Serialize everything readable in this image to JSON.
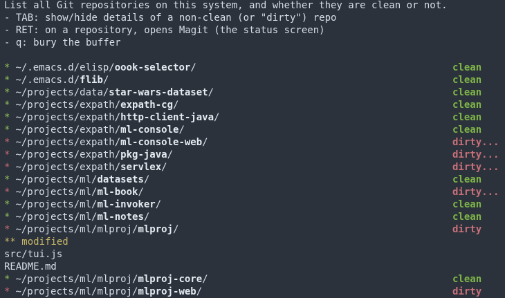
{
  "help": {
    "title": "List all Git repositories on this system, and whether they are clean or not.",
    "tab_line": "- TAB: show/hide details of a non-clean (or \"dirty\") repo",
    "ret_line": "- RET: on a repository, opens Magit (the status screen)",
    "q_line": "- q: bury the buffer"
  },
  "bullet": "*",
  "repos": [
    {
      "prefix": "~/.emacs.d/elisp/",
      "name": "oook-selector",
      "status": "clean"
    },
    {
      "prefix": "~/.emacs.d/",
      "name": "flib",
      "status": "clean"
    },
    {
      "prefix": "~/projects/data/",
      "name": "star-wars-dataset",
      "status": "clean"
    },
    {
      "prefix": "~/projects/expath/",
      "name": "expath-cg",
      "status": "clean"
    },
    {
      "prefix": "~/projects/expath/",
      "name": "http-client-java",
      "status": "clean"
    },
    {
      "prefix": "~/projects/expath/",
      "name": "ml-console",
      "status": "clean"
    },
    {
      "prefix": "~/projects/expath/",
      "name": "ml-console-web",
      "status": "dirty..."
    },
    {
      "prefix": "~/projects/expath/",
      "name": "pkg-java",
      "status": "dirty..."
    },
    {
      "prefix": "~/projects/expath/",
      "name": "servlex",
      "status": "dirty..."
    },
    {
      "prefix": "~/projects/ml/",
      "name": "datasets",
      "status": "clean"
    },
    {
      "prefix": "~/projects/ml/",
      "name": "ml-book",
      "status": "dirty..."
    },
    {
      "prefix": "~/projects/ml/",
      "name": "ml-invoker",
      "status": "clean"
    },
    {
      "prefix": "~/projects/ml/",
      "name": "ml-notes",
      "status": "clean"
    },
    {
      "prefix": "~/projects/ml/mlproj/",
      "name": "mlproj",
      "status": "dirty"
    }
  ],
  "details": {
    "heading": "** modified",
    "files": [
      "src/tui.js",
      "README.md"
    ]
  },
  "repos_after": [
    {
      "prefix": "~/projects/ml/mlproj/",
      "name": "mlproj-core",
      "status": "clean"
    },
    {
      "prefix": "~/projects/ml/mlproj/",
      "name": "mlproj-web",
      "status": "dirty"
    }
  ],
  "colors": {
    "background": "#2b323b",
    "clean": "#7fb548",
    "dirty": "#c9707a",
    "modified_heading": "#c6b56a"
  }
}
